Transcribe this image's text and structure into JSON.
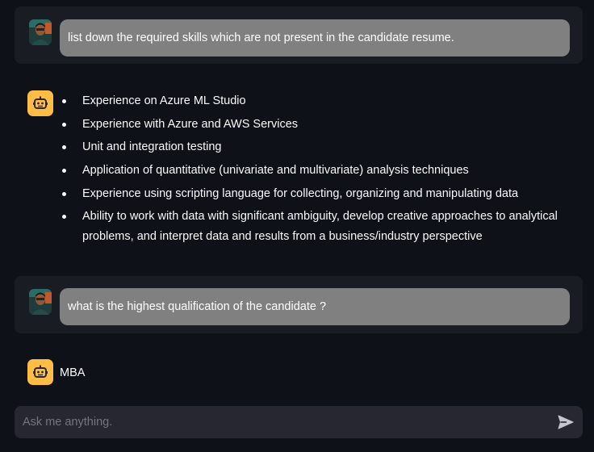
{
  "messages": [
    {
      "role": "user",
      "avatar_icon": "user-photo-avatar",
      "text": "list down the required skills which are not present in the candidate resume."
    },
    {
      "role": "assistant",
      "avatar_icon": "robot-icon",
      "items": [
        "Experience on Azure ML Studio",
        "Experience with Azure and AWS Services",
        "Unit and integration testing",
        "Application of quantitative (univariate and multivariate) analysis techniques",
        "Experience using scripting language for collecting, organizing and manipulating data",
        "Ability to work with data with significant ambiguity, develop creative approaches to analytical problems, and interpret data and results from a business/industry perspective"
      ]
    },
    {
      "role": "user",
      "avatar_icon": "user-photo-avatar",
      "text": "what is the highest qualification of the candidate ?"
    },
    {
      "role": "assistant",
      "avatar_icon": "robot-icon",
      "text": "MBA"
    }
  ],
  "chat_input": {
    "placeholder": "Ask me anything.",
    "value": "",
    "send_icon": "send-icon"
  },
  "colors": {
    "background": "#0e1117",
    "user_message_bg": "#1a1c24",
    "user_bubble_bg": "#808080",
    "bot_avatar_bg": "#ffbd45",
    "input_bg": "#262730"
  }
}
